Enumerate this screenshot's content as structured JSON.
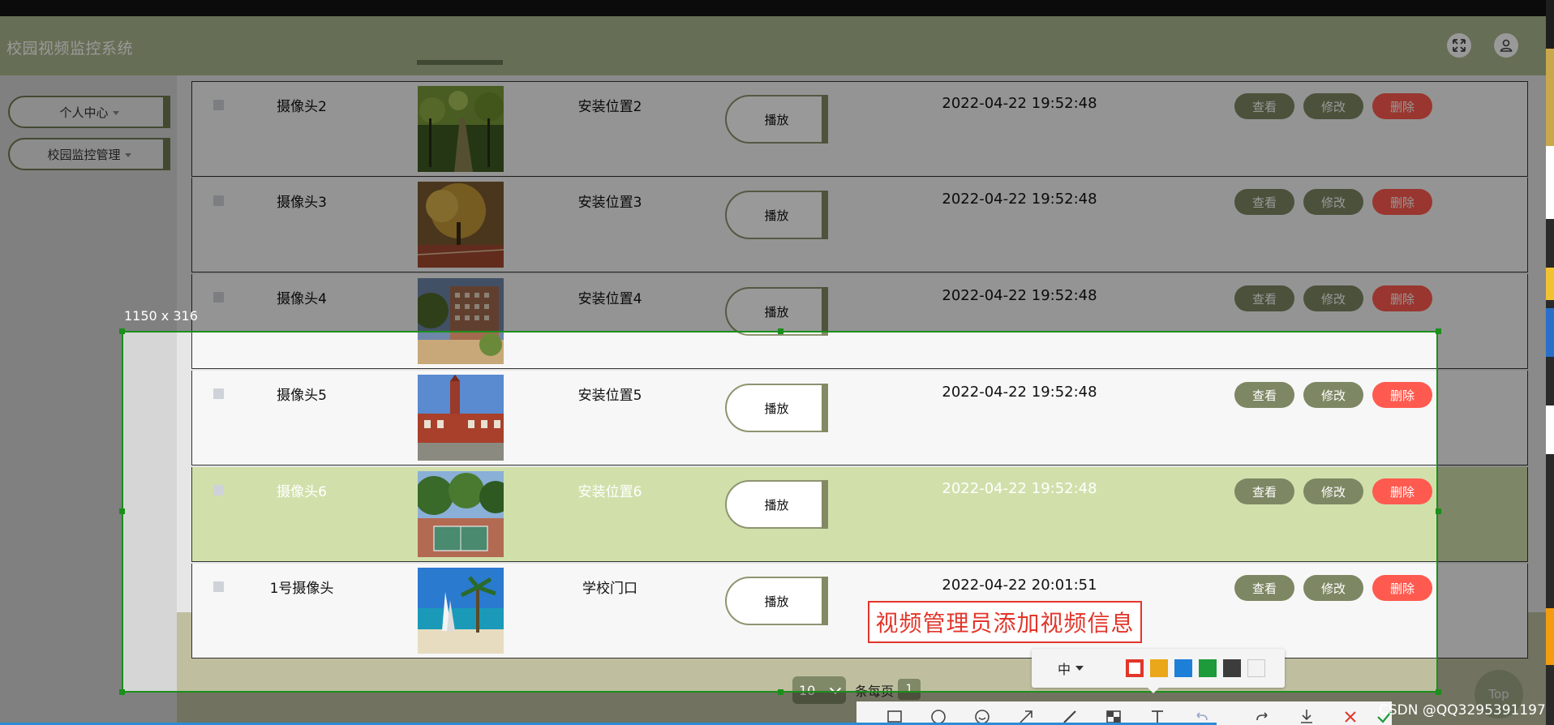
{
  "app": {
    "title": "校园视频监控系统",
    "header_icons": [
      "expand-icon",
      "user-icon"
    ]
  },
  "sidebar": {
    "items": [
      {
        "label": "个人中心"
      },
      {
        "label": "校园监控管理"
      }
    ]
  },
  "table": {
    "play_label": "播放",
    "actions": {
      "view": "查看",
      "edit": "修改",
      "delete": "删除"
    },
    "rows": [
      {
        "name": "摄像头2",
        "location": "安装位置2",
        "time": "2022-04-22 19:52:48",
        "thumb": "forest-path"
      },
      {
        "name": "摄像头3",
        "location": "安装位置3",
        "time": "2022-04-22 19:52:48",
        "thumb": "autumn-tree-court"
      },
      {
        "name": "摄像头4",
        "location": "安装位置4",
        "time": "2022-04-22 19:52:48",
        "thumb": "campus-building"
      },
      {
        "name": "摄像头5",
        "location": "安装位置5",
        "time": "2022-04-22 19:52:48",
        "thumb": "clock-tower"
      },
      {
        "name": "摄像头6",
        "location": "安装位置6",
        "time": "2022-04-22 19:52:48",
        "thumb": "basketball-court",
        "selected": true
      },
      {
        "name": "1号摄像头",
        "location": "学校门口",
        "time": "2022-04-22 20:01:51",
        "thumb": "beach-palm"
      }
    ]
  },
  "pagination": {
    "page_size": "10",
    "per_page_label": "条每页",
    "current_page": "1"
  },
  "screenshot_tool": {
    "selection_size": "1150 x 316",
    "annotation_text": "视频管理员添加视频信息",
    "font_size_option": "中",
    "colors": [
      "#e2362b",
      "#e9a719",
      "#1d7fd8",
      "#1d9a3a",
      "#3c3c3c",
      "#f2f2f2"
    ],
    "tools": [
      "rectangle-icon",
      "ellipse-icon",
      "emoji-icon",
      "arrow-icon",
      "pen-icon",
      "mosaic-icon",
      "text-icon",
      "undo-icon",
      "redo-icon",
      "download-icon",
      "close-icon",
      "check-icon"
    ]
  },
  "back_to_top": "Top",
  "watermark": "CSDN @QQ3295391197",
  "colors": {
    "header": "#aab88e",
    "accent": "#7d8763",
    "delete": "#ff5a4f",
    "selected_row": "#d1e0ab",
    "selection_border": "#1b8e1b"
  }
}
